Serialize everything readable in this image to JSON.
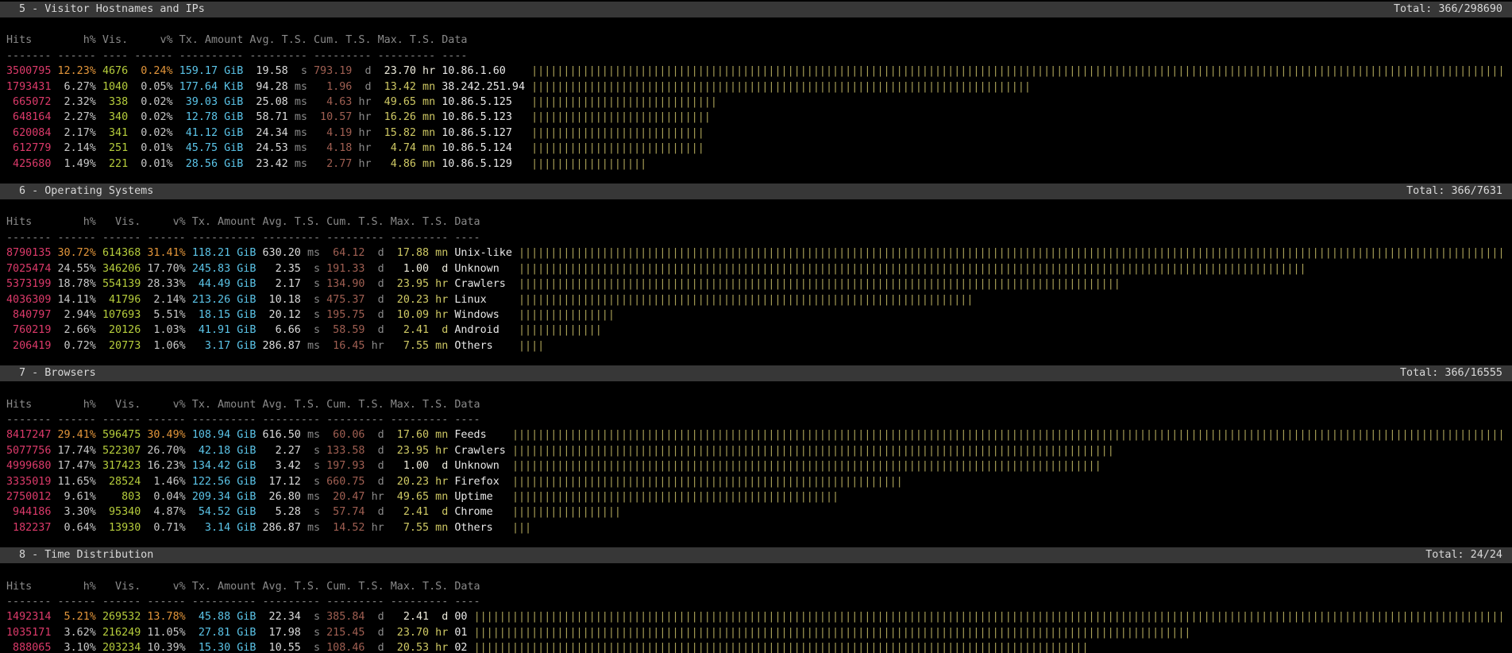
{
  "app_title": "GoAccess Web Log Analyzer Dashboard",
  "columns": [
    "Hits",
    "h%",
    "Vis.",
    "v%",
    "Tx. Amount",
    "Avg. T.S.",
    "Cum. T.S.",
    "Max. T.S.",
    "Data"
  ],
  "colors": {
    "background": "#000000",
    "panel_header_bg": "#373737",
    "panel_header_fg": "#d8d8d8",
    "column_header_fg": "#8a8a8a",
    "hits": "#dc3a6a",
    "pct": "#c8c8c8",
    "pct_max": "#e2953a",
    "visitors": "#b6cd3c",
    "tx": "#5bc4e8",
    "avg": "#dcdcdc",
    "unit": "#8a8a8a",
    "cum": "#a05f52",
    "max_ts": "#cfc964",
    "max_ts_hl": "#eceadb",
    "data": "#e8e8e8",
    "bars": "#aba258"
  },
  "chart_data": [
    {
      "type": "bar",
      "title": "5 - Visitor Hostnames and IPs",
      "categories": [
        "10.86.1.60",
        "38.242.251.94",
        "10.86.5.125",
        "10.86.5.123",
        "10.86.5.127",
        "10.86.5.124",
        "10.86.5.129"
      ],
      "values": [
        3500795,
        1793431,
        665072,
        648164,
        620084,
        612779,
        425680
      ]
    },
    {
      "type": "bar",
      "title": "6 - Operating Systems",
      "categories": [
        "Unix-like",
        "Unknown",
        "Crawlers",
        "Linux",
        "Windows",
        "Android",
        "Others"
      ],
      "values": [
        8790135,
        7025474,
        5373199,
        4036309,
        840797,
        760219,
        206419
      ]
    },
    {
      "type": "bar",
      "title": "7 - Browsers",
      "categories": [
        "Feeds",
        "Crawlers",
        "Unknown",
        "Firefox",
        "Uptime",
        "Chrome",
        "Others"
      ],
      "values": [
        8417247,
        5077756,
        4999680,
        3335019,
        2750012,
        944186,
        182237
      ]
    },
    {
      "type": "bar",
      "title": "8 - Time Distribution",
      "categories": [
        "00",
        "01",
        "02"
      ],
      "values": [
        1492314,
        1035171,
        888065
      ]
    }
  ],
  "panels": [
    {
      "title": "5 - Visitor Hostnames and IPs",
      "total_label": "Total: 366/298690",
      "vis_width": 4,
      "data_width": 13,
      "rows": [
        {
          "hits": "3500795",
          "hits_pct": "12.23%",
          "vis": "4676",
          "vis_pct": "0.24%",
          "tx": "159.17",
          "tx_unit": "GiB",
          "avg": "19.58",
          "avg_unit": "s",
          "cum": "793.19",
          "cum_unit": "d",
          "max": "23.70",
          "max_unit": "hr",
          "data": "10.86.1.60",
          "hl_pct": true,
          "hl_max": true
        },
        {
          "hits": "1793431",
          "hits_pct": "6.27%",
          "vis": "1040",
          "vis_pct": "0.05%",
          "tx": "177.64",
          "tx_unit": "KiB",
          "avg": "94.28",
          "avg_unit": "ms",
          "cum": "1.96",
          "cum_unit": "d",
          "max": "13.42",
          "max_unit": "mn",
          "data": "38.242.251.94",
          "hl_pct": false,
          "hl_max": false
        },
        {
          "hits": "665072",
          "hits_pct": "2.32%",
          "vis": "338",
          "vis_pct": "0.02%",
          "tx": "39.03",
          "tx_unit": "GiB",
          "avg": "25.08",
          "avg_unit": "ms",
          "cum": "4.63",
          "cum_unit": "hr",
          "max": "49.65",
          "max_unit": "mn",
          "data": "10.86.5.125",
          "hl_pct": false,
          "hl_max": false
        },
        {
          "hits": "648164",
          "hits_pct": "2.27%",
          "vis": "340",
          "vis_pct": "0.02%",
          "tx": "12.78",
          "tx_unit": "GiB",
          "avg": "58.71",
          "avg_unit": "ms",
          "cum": "10.57",
          "cum_unit": "hr",
          "max": "16.26",
          "max_unit": "mn",
          "data": "10.86.5.123",
          "hl_pct": false,
          "hl_max": false
        },
        {
          "hits": "620084",
          "hits_pct": "2.17%",
          "vis": "341",
          "vis_pct": "0.02%",
          "tx": "41.12",
          "tx_unit": "GiB",
          "avg": "24.34",
          "avg_unit": "ms",
          "cum": "4.19",
          "cum_unit": "hr",
          "max": "15.82",
          "max_unit": "mn",
          "data": "10.86.5.127",
          "hl_pct": false,
          "hl_max": false
        },
        {
          "hits": "612779",
          "hits_pct": "2.14%",
          "vis": "251",
          "vis_pct": "0.01%",
          "tx": "45.75",
          "tx_unit": "GiB",
          "avg": "24.53",
          "avg_unit": "ms",
          "cum": "4.18",
          "cum_unit": "hr",
          "max": "4.74",
          "max_unit": "mn",
          "data": "10.86.5.124",
          "hl_pct": false,
          "hl_max": false
        },
        {
          "hits": "425680",
          "hits_pct": "1.49%",
          "vis": "221",
          "vis_pct": "0.01%",
          "tx": "28.56",
          "tx_unit": "GiB",
          "avg": "23.42",
          "avg_unit": "ms",
          "cum": "2.77",
          "cum_unit": "hr",
          "max": "4.86",
          "max_unit": "mn",
          "data": "10.86.5.129",
          "hl_pct": false,
          "hl_max": false
        }
      ]
    },
    {
      "title": "6 - Operating Systems",
      "total_label": "Total: 366/7631",
      "vis_width": 6,
      "data_width": 9,
      "rows": [
        {
          "hits": "8790135",
          "hits_pct": "30.72%",
          "vis": "614368",
          "vis_pct": "31.41%",
          "tx": "118.21",
          "tx_unit": "GiB",
          "avg": "630.20",
          "avg_unit": "ms",
          "cum": "64.12",
          "cum_unit": "d",
          "max": "17.88",
          "max_unit": "mn",
          "data": "Unix-like",
          "hl_pct": true,
          "hl_max": false
        },
        {
          "hits": "7025474",
          "hits_pct": "24.55%",
          "vis": "346206",
          "vis_pct": "17.70%",
          "tx": "245.83",
          "tx_unit": "GiB",
          "avg": "2.35",
          "avg_unit": "s",
          "cum": "191.33",
          "cum_unit": "d",
          "max": "1.00",
          "max_unit": "d",
          "data": "Unknown",
          "hl_pct": false,
          "hl_max": true
        },
        {
          "hits": "5373199",
          "hits_pct": "18.78%",
          "vis": "554139",
          "vis_pct": "28.33%",
          "tx": "44.49",
          "tx_unit": "GiB",
          "avg": "2.17",
          "avg_unit": "s",
          "cum": "134.90",
          "cum_unit": "d",
          "max": "23.95",
          "max_unit": "hr",
          "data": "Crawlers",
          "hl_pct": false,
          "hl_max": false
        },
        {
          "hits": "4036309",
          "hits_pct": "14.11%",
          "vis": "41796",
          "vis_pct": "2.14%",
          "tx": "213.26",
          "tx_unit": "GiB",
          "avg": "10.18",
          "avg_unit": "s",
          "cum": "475.37",
          "cum_unit": "d",
          "max": "20.23",
          "max_unit": "hr",
          "data": "Linux",
          "hl_pct": false,
          "hl_max": false
        },
        {
          "hits": "840797",
          "hits_pct": "2.94%",
          "vis": "107693",
          "vis_pct": "5.51%",
          "tx": "18.15",
          "tx_unit": "GiB",
          "avg": "20.12",
          "avg_unit": "s",
          "cum": "195.75",
          "cum_unit": "d",
          "max": "10.09",
          "max_unit": "hr",
          "data": "Windows",
          "hl_pct": false,
          "hl_max": false
        },
        {
          "hits": "760219",
          "hits_pct": "2.66%",
          "vis": "20126",
          "vis_pct": "1.03%",
          "tx": "41.91",
          "tx_unit": "GiB",
          "avg": "6.66",
          "avg_unit": "s",
          "cum": "58.59",
          "cum_unit": "d",
          "max": "2.41",
          "max_unit": "d",
          "data": "Android",
          "hl_pct": false,
          "hl_max": false
        },
        {
          "hits": "206419",
          "hits_pct": "0.72%",
          "vis": "20773",
          "vis_pct": "1.06%",
          "tx": "3.17",
          "tx_unit": "GiB",
          "avg": "286.87",
          "avg_unit": "ms",
          "cum": "16.45",
          "cum_unit": "hr",
          "max": "7.55",
          "max_unit": "mn",
          "data": "Others",
          "hl_pct": false,
          "hl_max": false
        }
      ]
    },
    {
      "title": "7 - Browsers",
      "total_label": "Total: 366/16555",
      "vis_width": 6,
      "data_width": 8,
      "rows": [
        {
          "hits": "8417247",
          "hits_pct": "29.41%",
          "vis": "596475",
          "vis_pct": "30.49%",
          "tx": "108.94",
          "tx_unit": "GiB",
          "avg": "616.50",
          "avg_unit": "ms",
          "cum": "60.06",
          "cum_unit": "d",
          "max": "17.60",
          "max_unit": "mn",
          "data": "Feeds",
          "hl_pct": true,
          "hl_max": false
        },
        {
          "hits": "5077756",
          "hits_pct": "17.74%",
          "vis": "522307",
          "vis_pct": "26.70%",
          "tx": "42.18",
          "tx_unit": "GiB",
          "avg": "2.27",
          "avg_unit": "s",
          "cum": "133.58",
          "cum_unit": "d",
          "max": "23.95",
          "max_unit": "hr",
          "data": "Crawlers",
          "hl_pct": false,
          "hl_max": false
        },
        {
          "hits": "4999680",
          "hits_pct": "17.47%",
          "vis": "317423",
          "vis_pct": "16.23%",
          "tx": "134.42",
          "tx_unit": "GiB",
          "avg": "3.42",
          "avg_unit": "s",
          "cum": "197.93",
          "cum_unit": "d",
          "max": "1.00",
          "max_unit": "d",
          "data": "Unknown",
          "hl_pct": false,
          "hl_max": true
        },
        {
          "hits": "3335019",
          "hits_pct": "11.65%",
          "vis": "28524",
          "vis_pct": "1.46%",
          "tx": "122.56",
          "tx_unit": "GiB",
          "avg": "17.12",
          "avg_unit": "s",
          "cum": "660.75",
          "cum_unit": "d",
          "max": "20.23",
          "max_unit": "hr",
          "data": "Firefox",
          "hl_pct": false,
          "hl_max": false
        },
        {
          "hits": "2750012",
          "hits_pct": "9.61%",
          "vis": "803",
          "vis_pct": "0.04%",
          "tx": "209.34",
          "tx_unit": "GiB",
          "avg": "26.80",
          "avg_unit": "ms",
          "cum": "20.47",
          "cum_unit": "hr",
          "max": "49.65",
          "max_unit": "mn",
          "data": "Uptime",
          "hl_pct": false,
          "hl_max": false
        },
        {
          "hits": "944186",
          "hits_pct": "3.30%",
          "vis": "95340",
          "vis_pct": "4.87%",
          "tx": "54.52",
          "tx_unit": "GiB",
          "avg": "5.28",
          "avg_unit": "s",
          "cum": "57.74",
          "cum_unit": "d",
          "max": "2.41",
          "max_unit": "d",
          "data": "Chrome",
          "hl_pct": false,
          "hl_max": false
        },
        {
          "hits": "182237",
          "hits_pct": "0.64%",
          "vis": "13930",
          "vis_pct": "0.71%",
          "tx": "3.14",
          "tx_unit": "GiB",
          "avg": "286.87",
          "avg_unit": "ms",
          "cum": "14.52",
          "cum_unit": "hr",
          "max": "7.55",
          "max_unit": "mn",
          "data": "Others",
          "hl_pct": false,
          "hl_max": false
        }
      ]
    },
    {
      "title": "8 - Time Distribution",
      "total_label": "Total: 24/24",
      "vis_width": 6,
      "data_width": 2,
      "rows": [
        {
          "hits": "1492314",
          "hits_pct": "5.21%",
          "vis": "269532",
          "vis_pct": "13.78%",
          "tx": "45.88",
          "tx_unit": "GiB",
          "avg": "22.34",
          "avg_unit": "s",
          "cum": "385.84",
          "cum_unit": "d",
          "max": "2.41",
          "max_unit": "d",
          "data": "00",
          "hl_pct": true,
          "hl_max": true
        },
        {
          "hits": "1035171",
          "hits_pct": "3.62%",
          "vis": "216249",
          "vis_pct": "11.05%",
          "tx": "27.81",
          "tx_unit": "GiB",
          "avg": "17.98",
          "avg_unit": "s",
          "cum": "215.45",
          "cum_unit": "d",
          "max": "23.70",
          "max_unit": "hr",
          "data": "01",
          "hl_pct": false,
          "hl_max": false
        },
        {
          "hits": "888065",
          "hits_pct": "3.10%",
          "vis": "203234",
          "vis_pct": "10.39%",
          "tx": "15.30",
          "tx_unit": "GiB",
          "avg": "10.55",
          "avg_unit": "s",
          "cum": "108.46",
          "cum_unit": "d",
          "max": "20.53",
          "max_unit": "hr",
          "data": "02",
          "hl_pct": false,
          "hl_max": false
        }
      ]
    }
  ]
}
